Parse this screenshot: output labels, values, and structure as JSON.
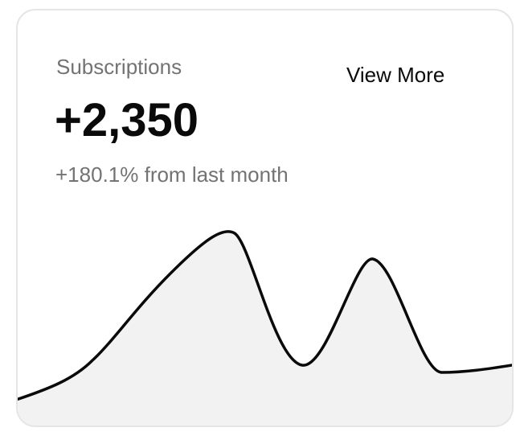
{
  "card": {
    "title": "Subscriptions",
    "value": "+2,350",
    "change_text": "+180.1% from last month",
    "view_more_label": "View More"
  },
  "colors": {
    "line": "#0a0a0a",
    "area_fill": "#f2f2f2",
    "muted_text": "#737373",
    "border": "#e5e5e5"
  }
}
